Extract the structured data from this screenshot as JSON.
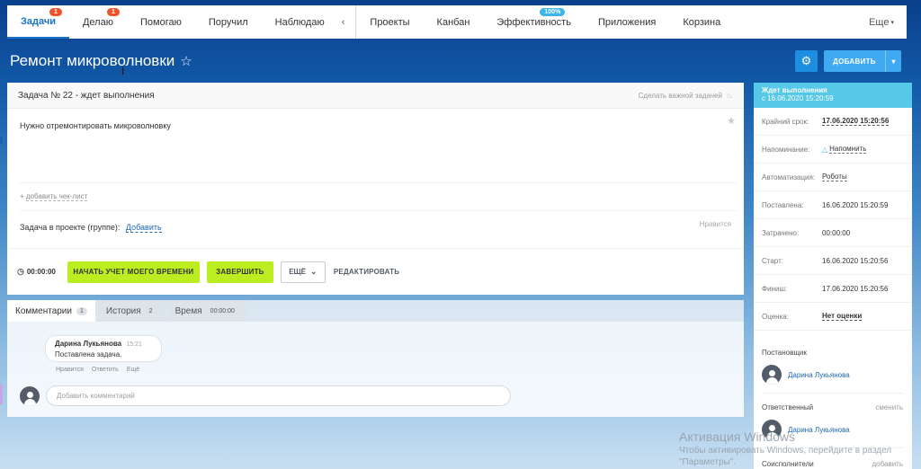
{
  "nav": {
    "items": [
      {
        "label": "Задачи",
        "badge": "1",
        "active": true
      },
      {
        "label": "Делаю",
        "badge": "1"
      },
      {
        "label": "Помогаю"
      },
      {
        "label": "Поручил"
      },
      {
        "label": "Наблюдаю"
      },
      {
        "label": "Проекты"
      },
      {
        "label": "Канбан"
      },
      {
        "label": "Эффективность",
        "badge": "100%"
      },
      {
        "label": "Приложения"
      },
      {
        "label": "Корзина"
      }
    ],
    "collapse_arrow": "‹",
    "more_label": "Еще"
  },
  "title": "Ремонт микроволновки",
  "toolbar": {
    "add_label": "ДОБАВИТЬ"
  },
  "task": {
    "header": "Задача № 22 - ждет выполнения",
    "make_important": "Сделать важной задачей",
    "description": "Нужно отремонтировать микроволновку",
    "checklist_label": "добавить чек-лист",
    "project_label": "Задача в проекте (группе):",
    "project_add": "Добавить",
    "likes_label": "Нравится"
  },
  "actions": {
    "timer": "00:00:00",
    "start_time": "НАЧАТЬ УЧЕТ МОЕГО ВРЕМЕНИ",
    "finish": "ЗАВЕРШИТЬ",
    "more": "ЕЩЁ",
    "edit": "РЕДАКТИРОВАТЬ"
  },
  "tabs": [
    {
      "label": "Комментарии",
      "count": "1",
      "active": true
    },
    {
      "label": "История",
      "count": "2"
    },
    {
      "label": "Время",
      "count": "00:00:00"
    }
  ],
  "comment": {
    "author": "Дарина Лукьянова",
    "time": "15:21",
    "text": "Поставлена задача.",
    "actions": [
      "Нравится",
      "Ответить",
      "Ещё"
    ]
  },
  "comment_input": {
    "placeholder": "Добавить комментарий"
  },
  "sidebar": {
    "status": "Ждет выполнения",
    "since": "с 16.06.2020 15:20:59",
    "rows": [
      {
        "label": "Крайний срок:",
        "value": "17.06.2020 15:20:56"
      },
      {
        "label": "Напоминание:",
        "value": "Напомнить"
      },
      {
        "label": "Автоматизация:",
        "value": "Роботы"
      },
      {
        "label": "Поставлена:",
        "value": "16.06.2020 15:20:59"
      },
      {
        "label": "Затрачено:",
        "value": "00:00:00"
      },
      {
        "label": "Старт:",
        "value": "16.06.2020 15:20:56"
      },
      {
        "label": "Финиш:",
        "value": "17.06.2020 15:20:56"
      },
      {
        "label": "Оценка:",
        "value": "Нет оценки"
      }
    ],
    "creator_label": "Постановщик",
    "creator_name": "Дарина Лукьянова",
    "responsible_label": "Ответственный",
    "responsible_change": "сменить",
    "responsible_name": "Дарина Лукьянова",
    "coexec_label": "Соисполнители",
    "coexec_add": "добавить"
  },
  "watermark": {
    "title": "Активация Windows",
    "line1": "Чтобы активировать Windows, перейдите в раздел",
    "line2": "\"Параметры\"."
  }
}
